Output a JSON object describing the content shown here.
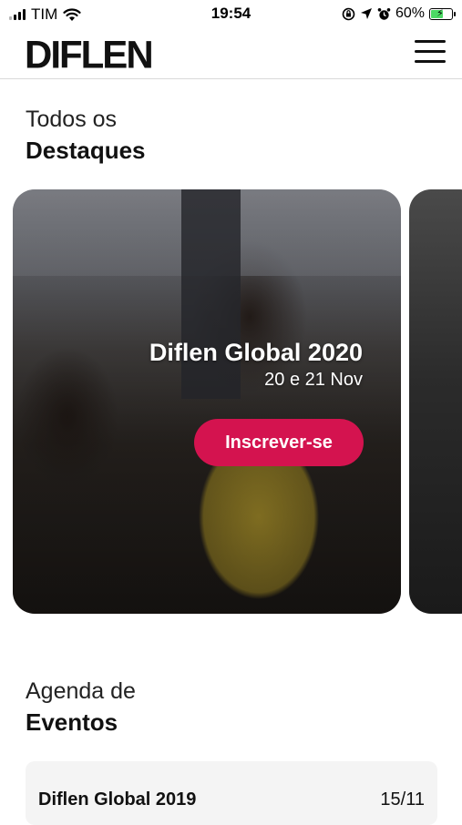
{
  "status_bar": {
    "carrier": "TIM",
    "time": "19:54",
    "battery_percent": "60%",
    "battery_level": 0.6,
    "battery_color": "#4cd964"
  },
  "header": {
    "logo": "DIFLEN",
    "menu_icon": "hamburger-menu-icon"
  },
  "highlights": {
    "title_light": "Todos os",
    "title_bold": "Destaques",
    "cards": [
      {
        "title": "Diflen Global 2020",
        "date": "20 e 21 Nov",
        "button_label": "Inscrever-se",
        "button_color": "#d4134f"
      }
    ]
  },
  "events": {
    "title_light": "Agenda de",
    "title_bold": "Eventos",
    "items": [
      {
        "name": "Diflen Global 2019",
        "date": "15/11"
      }
    ]
  }
}
